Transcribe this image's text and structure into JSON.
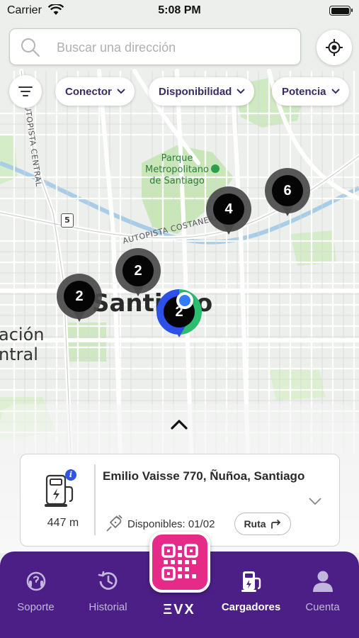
{
  "status_bar": {
    "carrier": "Carrier",
    "time": "5:08 PM"
  },
  "search": {
    "placeholder": "Buscar una dirección"
  },
  "filters": [
    {
      "label": "Conector"
    },
    {
      "label": "Disponibilidad"
    },
    {
      "label": "Potencia"
    }
  ],
  "map": {
    "street_labels": [
      "AUTOPISTA CENTRAL",
      "AUTOPISTA COSTANERA"
    ],
    "route_shield": "5",
    "park_label": "Parque\nMetropolitano\nde Santiago",
    "city_label": "Santiago",
    "comuna_label": "ación\nntral",
    "clusters": [
      {
        "count": "6",
        "selected": false
      },
      {
        "count": "4",
        "selected": false
      },
      {
        "count": "2",
        "selected": false
      },
      {
        "count": "2",
        "selected": false
      },
      {
        "count": "2",
        "selected": true
      }
    ]
  },
  "card": {
    "distance": "447 m",
    "address": "Emilio Vaisse 770, Ñuñoa, Santiago",
    "availability": "Disponibles: 01/02",
    "route_button": "Ruta"
  },
  "tabbar": {
    "tabs": [
      {
        "label": "Soporte",
        "icon": "support-icon",
        "active": false
      },
      {
        "label": "Historial",
        "icon": "history-icon",
        "active": false
      },
      {
        "label": "Cargadores",
        "icon": "charger-icon",
        "active": true
      },
      {
        "label": "Cuenta",
        "icon": "account-icon",
        "active": false
      }
    ],
    "brand": "ΞVX",
    "center_icon": "qr-code-icon"
  },
  "colors": {
    "primary": "#4b1f85",
    "accent": "#e62a88",
    "available": "#2dbd6e",
    "selected_blue": "#2c50e8",
    "cluster_dark": "#050505"
  }
}
